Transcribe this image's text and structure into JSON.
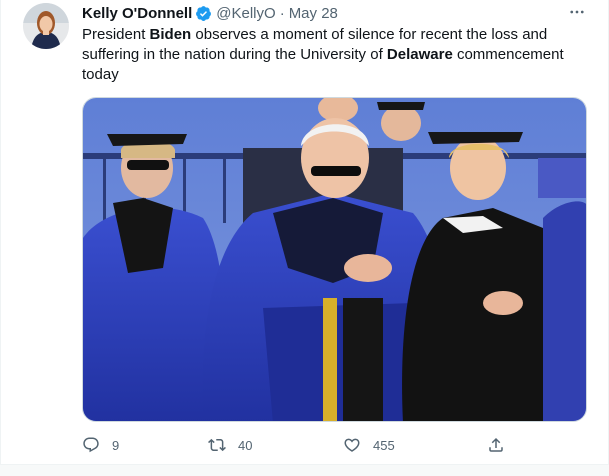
{
  "author": {
    "name": "Kelly O'Donnell",
    "handle": "@KellyO",
    "separator": "·",
    "date": "May 28",
    "verified": true
  },
  "tweet": {
    "text_parts": [
      {
        "text": "President ",
        "bold": false
      },
      {
        "text": "Biden",
        "bold": true
      },
      {
        "text": " observes a moment of silence for recent the loss and suffering in the nation during the University of ",
        "bold": false
      },
      {
        "text": "Delaware",
        "bold": true
      },
      {
        "text": " commencement today",
        "bold": false
      }
    ]
  },
  "actions": {
    "reply_count": "9",
    "retweet_count": "40",
    "like_count": "455"
  },
  "icons": {
    "verified": "verified-badge-icon",
    "more": "more-options-icon",
    "reply": "reply-bubble-icon",
    "retweet": "retweet-icon",
    "like": "heart-icon",
    "share": "share-icon"
  },
  "colors": {
    "text": "#0f1419",
    "muted": "#536471",
    "verified": "#1d9bf0",
    "gown_blue": "#2e3fb8"
  }
}
